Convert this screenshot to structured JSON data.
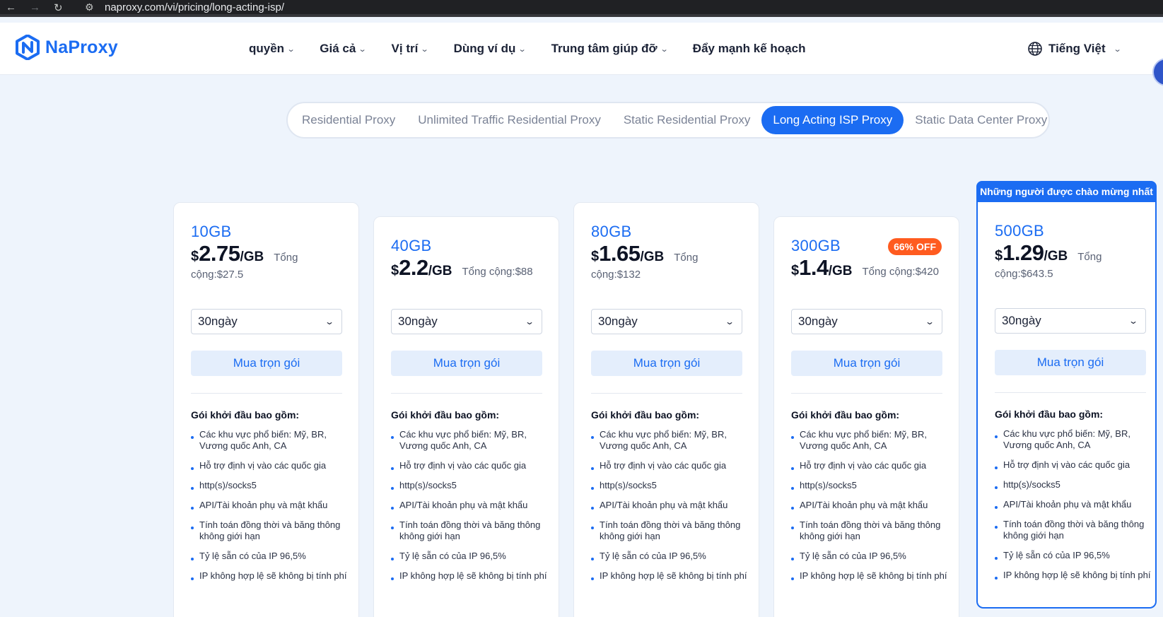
{
  "browser": {
    "url": "naproxy.com/vi/pricing/long-acting-isp/"
  },
  "brand": {
    "name": "NaProxy",
    "accent": "#1b6cf2",
    "discount_color": "#ff5b1f"
  },
  "nav": {
    "items": [
      {
        "label": "quyền",
        "dropdown": true
      },
      {
        "label": "Giá cả",
        "dropdown": true
      },
      {
        "label": "Vị trí",
        "dropdown": true
      },
      {
        "label": "Dùng ví dụ",
        "dropdown": true
      },
      {
        "label": "Trung tâm giúp đỡ",
        "dropdown": true
      },
      {
        "label": "Đẩy mạnh kế hoạch",
        "dropdown": false
      }
    ],
    "language": "Tiếng Việt"
  },
  "tabs": [
    {
      "label": "Residential Proxy",
      "active": false
    },
    {
      "label": "Unlimited Traffic Residential Proxy",
      "active": false
    },
    {
      "label": "Static Residential Proxy",
      "active": false
    },
    {
      "label": "Long Acting ISP Proxy",
      "active": true
    },
    {
      "label": "Static Data Center Proxy",
      "active": false
    }
  ],
  "common": {
    "currency": "$",
    "unit": "/GB",
    "buy_label": "Mua trọn gói",
    "duration": "30ngày",
    "includes_title": "Gói khởi đầu bao gồm:",
    "features": [
      "Các khu vực phổ biến: Mỹ, BR, Vương quốc Anh, CA",
      "Hỗ trợ định vị vào các quốc gia",
      "http(s)/socks5",
      "API/Tài khoản phụ và mật khẩu",
      "Tính toán đồng thời và băng thông không giới hạn",
      "Tỷ lệ sẵn có của IP 96,5%",
      "IP không hợp lệ sẽ không bị tính phí"
    ]
  },
  "featured_banner": "Những người được chào mừng nhất",
  "plans": [
    {
      "size": "10GB",
      "price": "2.75",
      "total": "Tổng cộng:$27.5",
      "discount": ""
    },
    {
      "size": "40GB",
      "price": "2.2",
      "total": "Tổng cộng:$88",
      "discount": ""
    },
    {
      "size": "80GB",
      "price": "1.65",
      "total": "Tổng cộng:$132",
      "discount": ""
    },
    {
      "size": "300GB",
      "price": "1.4",
      "total": "Tổng cộng:$420",
      "discount": "66% OFF"
    },
    {
      "size": "500GB",
      "price": "1.29",
      "total": "Tổng cộng:$643.5",
      "discount": ""
    }
  ]
}
